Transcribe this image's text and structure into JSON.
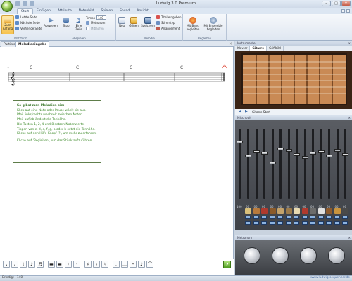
{
  "window": {
    "title": "Ludwig 3.0 Premium",
    "controls": {
      "min": "–",
      "max": "□",
      "close": "×"
    }
  },
  "ribbon_tabs": [
    "Start",
    "Einfügen",
    "Attribute",
    "Notenbild",
    "Spielen",
    "Sound",
    "Ansicht"
  ],
  "ribbon": {
    "abspielen": {
      "label": "Abspielen",
      "zum_anfang": "Zum Anfang",
      "letzte_seite": "Letzte Seite",
      "naechste_seite": "Nächste Seite",
      "vorherige_seite": "Vorherige Seite",
      "abspielen_btn": "Abspielen",
      "stop": "Stop",
      "eine_zeile": "Eine Zeile",
      "tempo_label": "Tempo",
      "tempo_value": "140",
      "metronom": "Metronom",
      "mitlaufen": "Mitlaufen"
    },
    "melodie": {
      "label": "Melodie",
      "neu": "Neu",
      "oeffnen": "Öffnen",
      "speichern": "Speichern",
      "titel_eingeben": "Titel eingeben",
      "stimmtyp": "Stimmtyp",
      "arrangement": "Arrangement"
    },
    "begleiten": {
      "label": "Begleiten",
      "mit_band": "Mit Band begleiten",
      "mit_ensemble": "Mit Ensemble begleiten"
    },
    "platform_label": "Plattform"
  },
  "doc_tabs": [
    "Partitur",
    "Melodieeingabe"
  ],
  "score": {
    "chords": [
      "C",
      "C",
      "C",
      "C"
    ],
    "measure_start": "1"
  },
  "info_box": {
    "title": "So gibst man Melodien ein:",
    "lines": [
      "Klick auf eine Note oder Pause wählt sie aus.",
      "Pfeil links/rechts wechselt zwischen Noten.",
      "Pfeil auf/ab ändert die Tonhöhe.",
      "Die Tasten 1, 2, 4 und 8 setzen Notenwerte.",
      "Tippen von c, d, e, f, g, a oder h setzt die Tonhöhe.",
      "Klicke auf den Hilfe-Knopf '?', um mehr zu erfahren."
    ],
    "footer": "Klicke auf 'Begleiten', um das Stück aufzuführen."
  },
  "palette": [
    "𝅝",
    "𝅗𝅥",
    "♩",
    "♪",
    "♬",
    "▬",
    "▬",
    "𝄽",
    "𝄾",
    "♯",
    "♭",
    "♮",
    ".",
    "…",
    "𝄐",
    "♪",
    "⌒"
  ],
  "help_label": "?",
  "status": {
    "left": "Erledigt - 140",
    "right": "www.ludwig-sequencer.de"
  },
  "right_panels": {
    "instrument_header": "Instrumente",
    "instrument_tabs": [
      "Klavier",
      "Gitarre",
      "Griffbild"
    ],
    "instrument_toolbar": "Gitarre Start",
    "mixer_header": "Mischpult",
    "metronome_header": "Metronom",
    "channel_numbers": [
      "00",
      "00",
      "00",
      "00",
      "00",
      "00",
      "00",
      "00",
      "00",
      "00",
      "00",
      "00",
      "00"
    ],
    "mixer_master": "100"
  },
  "colors": {
    "ribbon_active": "#f7c34f",
    "info_text": "#3d8a2a",
    "mixer_bg": "#4a4d53",
    "fretboard": "#c98a55"
  }
}
